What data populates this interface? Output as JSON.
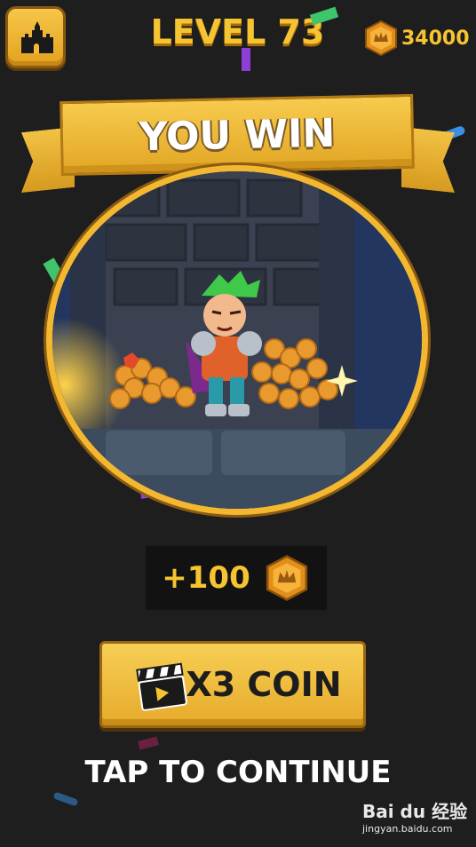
{
  "header": {
    "level_label": "LEVEL 73",
    "coin_balance": "34000",
    "home_icon": "castle-icon"
  },
  "banner": {
    "title": "YOU WIN"
  },
  "reward": {
    "amount": "+100",
    "icon": "crown-coin-icon"
  },
  "bonus_button": {
    "label": "X3 COIN",
    "icon": "clapperboard-icon"
  },
  "footer": {
    "tap_label": "TAP TO CONTINUE"
  },
  "watermark": {
    "brand": "Bai du 经验",
    "url": "jingyan.baidu.com"
  },
  "colors": {
    "gold": "#f7c431",
    "background": "#1e1e1e",
    "panel": "#121212"
  }
}
